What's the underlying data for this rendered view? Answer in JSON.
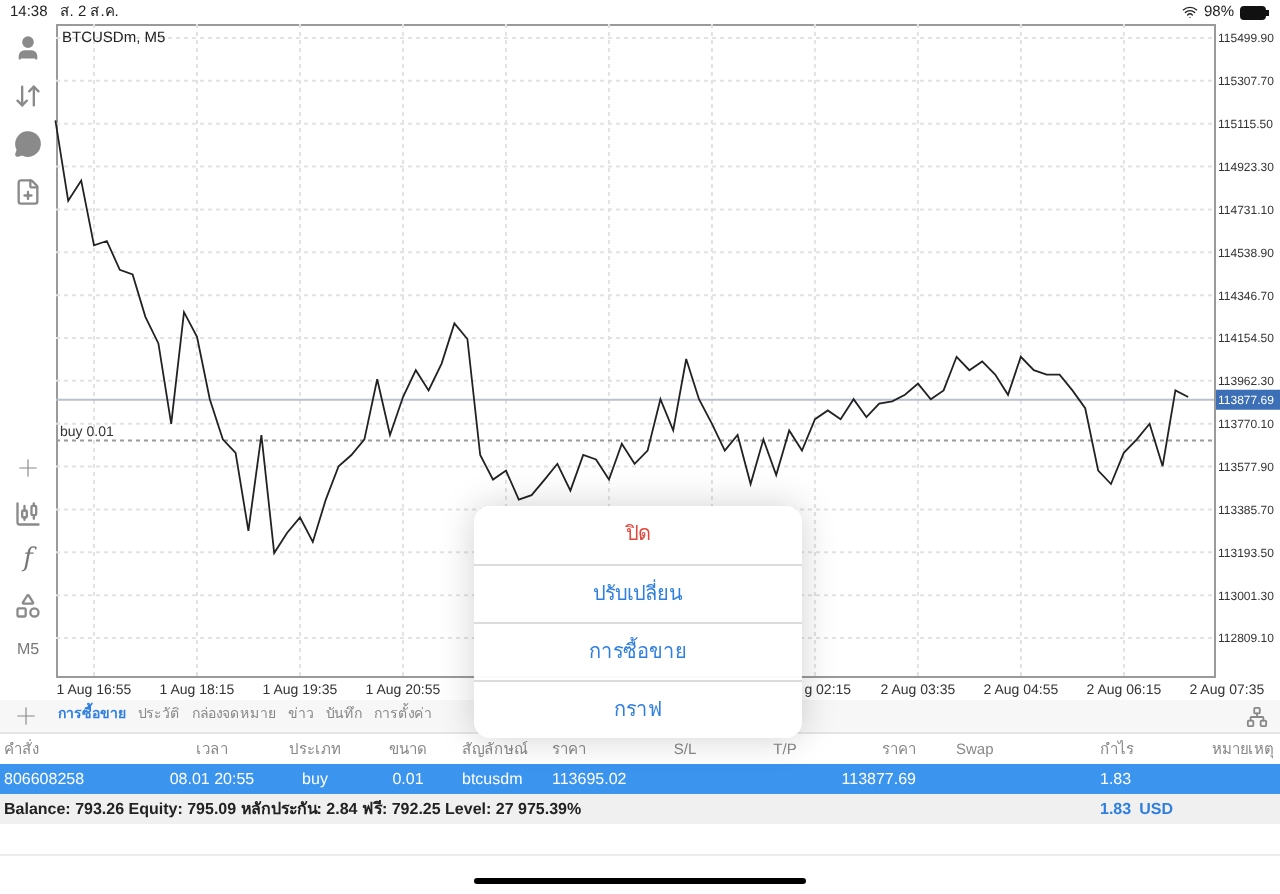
{
  "status_bar": {
    "time": "14:38",
    "date": "ส. 2 ส.ค.",
    "battery": "98%"
  },
  "toolbar": {
    "function_glyph": "f",
    "timeframe": "M5"
  },
  "chart": {
    "title": "BTCUSDm, M5",
    "chart_data": {
      "type": "line",
      "grid": true,
      "ylim": [
        112638.8,
        115562.7
      ],
      "categories": [
        null,
        null,
        null,
        "1 Aug 16:55",
        null,
        null,
        null,
        null,
        null,
        null,
        null,
        "1 Aug 18:15",
        null,
        null,
        null,
        null,
        null,
        null,
        null,
        "1 Aug 19:35",
        null,
        null,
        null,
        null,
        null,
        null,
        null,
        "1 Aug 20:55",
        null,
        null,
        null,
        null,
        null,
        null,
        null,
        null,
        null,
        null,
        null,
        null,
        null,
        null,
        null,
        null,
        null,
        null,
        null,
        null,
        null,
        null,
        null,
        null,
        null,
        null,
        null,
        null,
        null,
        null,
        null,
        null,
        "g 02:15",
        null,
        null,
        null,
        null,
        null,
        null,
        "2 Aug 03:35",
        null,
        null,
        null,
        null,
        null,
        null,
        null,
        "2 Aug 04:55",
        null,
        null,
        null,
        null,
        null,
        null,
        null,
        "2 Aug 06:15",
        null,
        null,
        null,
        null,
        null,
        null,
        null,
        "2 Aug 07:35"
      ],
      "series": [
        {
          "color": "#222222",
          "values": [
            115130,
            114770,
            114860,
            114570,
            114590,
            114460,
            114440,
            114250,
            114130,
            113770,
            114270,
            114160,
            113880,
            113700,
            113640,
            113290,
            113720,
            113190,
            113280,
            113350,
            113240,
            113430,
            113580,
            113630,
            113700,
            113970,
            113720,
            113890,
            114010,
            113920,
            114040,
            114220,
            114150,
            113630,
            113520,
            113560,
            113430,
            113450,
            113520,
            113590,
            113470,
            113630,
            113610,
            113520,
            113680,
            113590,
            113650,
            113880,
            113740,
            114060,
            113880,
            113770,
            113650,
            113720,
            113500,
            113700,
            113540,
            113740,
            113650,
            113790,
            113830,
            113790,
            113880,
            113800,
            113860,
            113870,
            113900,
            113950,
            113880,
            113920,
            114070,
            114010,
            114050,
            113990,
            113900,
            114070,
            114010,
            113990,
            113990,
            113920,
            113840,
            113560,
            113500,
            113640,
            113700,
            113770,
            113580,
            113920,
            113890,
            null,
            null,
            null
          ]
        }
      ],
      "yticks": [
        {
          "value": 115499.9,
          "label": "115499.90"
        },
        {
          "value": 115307.7,
          "label": "115307.70"
        },
        {
          "value": 115115.5,
          "label": "115115.50"
        },
        {
          "value": 114923.3,
          "label": "114923.30"
        },
        {
          "value": 114731.1,
          "label": "114731.10"
        },
        {
          "value": 114538.9,
          "label": "114538.90"
        },
        {
          "value": 114346.7,
          "label": "114346.70"
        },
        {
          "value": 114154.5,
          "label": "114154.50"
        },
        {
          "value": 113962.3,
          "label": "113962.30"
        },
        {
          "value": 113770.1,
          "label": "113770.10"
        },
        {
          "value": 113577.9,
          "label": "113577.90"
        },
        {
          "value": 113385.7,
          "label": "113385.70"
        },
        {
          "value": 113193.5,
          "label": "113193.50"
        },
        {
          "value": 113001.3,
          "label": "113001.30"
        },
        {
          "value": 112809.1,
          "label": "112809.10"
        }
      ],
      "ref_lines": [
        {
          "axis": "y",
          "value": 113877.69,
          "label": "113877.69"
        },
        {
          "axis": "y",
          "value": 113695.02,
          "label": "buy 0.01"
        }
      ]
    }
  },
  "action_sheet": [
    {
      "label": "ปิด",
      "kind": "destructive"
    },
    {
      "label": "ปรับเปลี่ยน",
      "kind": "default"
    },
    {
      "label": "การซื้อขาย",
      "kind": "default"
    },
    {
      "label": "กราฟ",
      "kind": "default"
    }
  ],
  "tabs": [
    {
      "label": "การซื้อขาย",
      "selected": true
    },
    {
      "label": "ประวัติ",
      "selected": false
    },
    {
      "label": "กล่องจดหมาย",
      "selected": false
    },
    {
      "label": "ข่าว",
      "selected": false
    },
    {
      "label": "บันทึก",
      "selected": false
    },
    {
      "label": "การตั้งค่า",
      "selected": false
    }
  ],
  "table": {
    "columns": [
      "คำสั่ง",
      "เวลา",
      "ประเภท",
      "ขนาด",
      "สัญลักษณ์",
      "ราคา",
      "S/L",
      "T/P",
      "ราคา",
      "Swap",
      "กำไร",
      "หมายเหตุ"
    ],
    "rows": [
      {
        "selected": true,
        "order": "806608258",
        "time": "08.01 20:55",
        "type": "buy",
        "volume": "0.01",
        "symbol": "btcusdm",
        "open_price": "113695.02",
        "price": "113877.69",
        "profit": "1.83"
      }
    ]
  },
  "summary": {
    "text": "Balance: 793.26 Equity: 795.09 หลักประกัน: 2.84 ฟรี: 792.25 Level: 27 975.39%",
    "profit": "1.83",
    "currency": "USD"
  }
}
